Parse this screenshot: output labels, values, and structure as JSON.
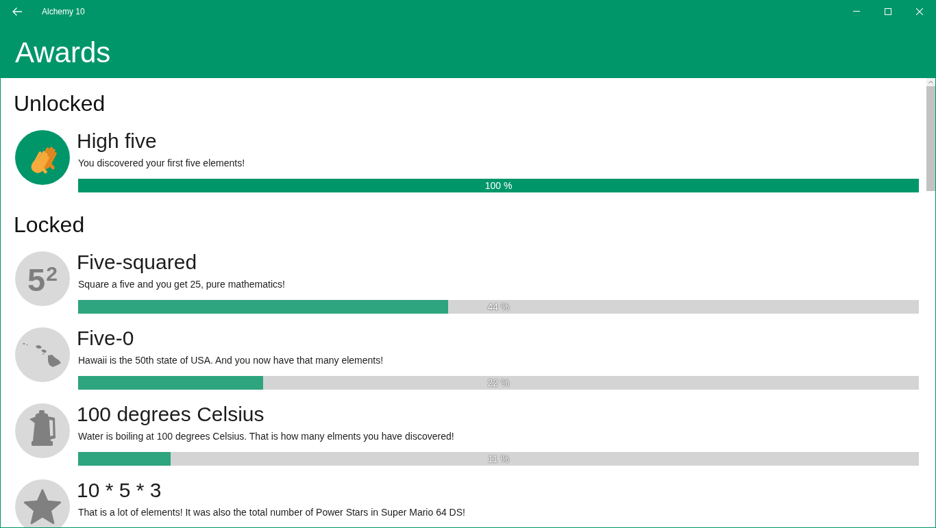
{
  "window": {
    "title": "Alchemy 10"
  },
  "header": {
    "title": "Awards"
  },
  "sections": [
    {
      "heading": "Unlocked",
      "awards": [
        {
          "kind": "hands",
          "locked": false,
          "title": "High five",
          "description": "You discovered your first five elements!",
          "level": 1,
          "reading": "100 %"
        }
      ]
    },
    {
      "heading": "Locked",
      "awards": [
        {
          "kind": "exponent",
          "icon_text": "5$^{2}$",
          "locked": true,
          "title": "Five-squared",
          "description": "Square a five and you get 25, pure mathematics!",
          "level": 0.44,
          "reading": "44 %"
        },
        {
          "kind": "islands",
          "locked": true,
          "title": "Five-0",
          "description": "Hawaii is the 50th state of USA. And you now have that many elements!",
          "level": 0.22,
          "reading": "22 %"
        },
        {
          "kind": "kettle",
          "locked": true,
          "title": "100 degrees Celsius",
          "description": "Water is boiling at 100 degrees Celsius. That is how many elments you have discovered!",
          "level": 0.11,
          "reading": "11 %"
        },
        {
          "kind": "star",
          "locked": true,
          "title": "10 * 5 * 3",
          "description": "That is a lot of elements! It was also the total number of Power Stars in Super Mario 64 DS!"
        }
      ]
    }
  ]
}
